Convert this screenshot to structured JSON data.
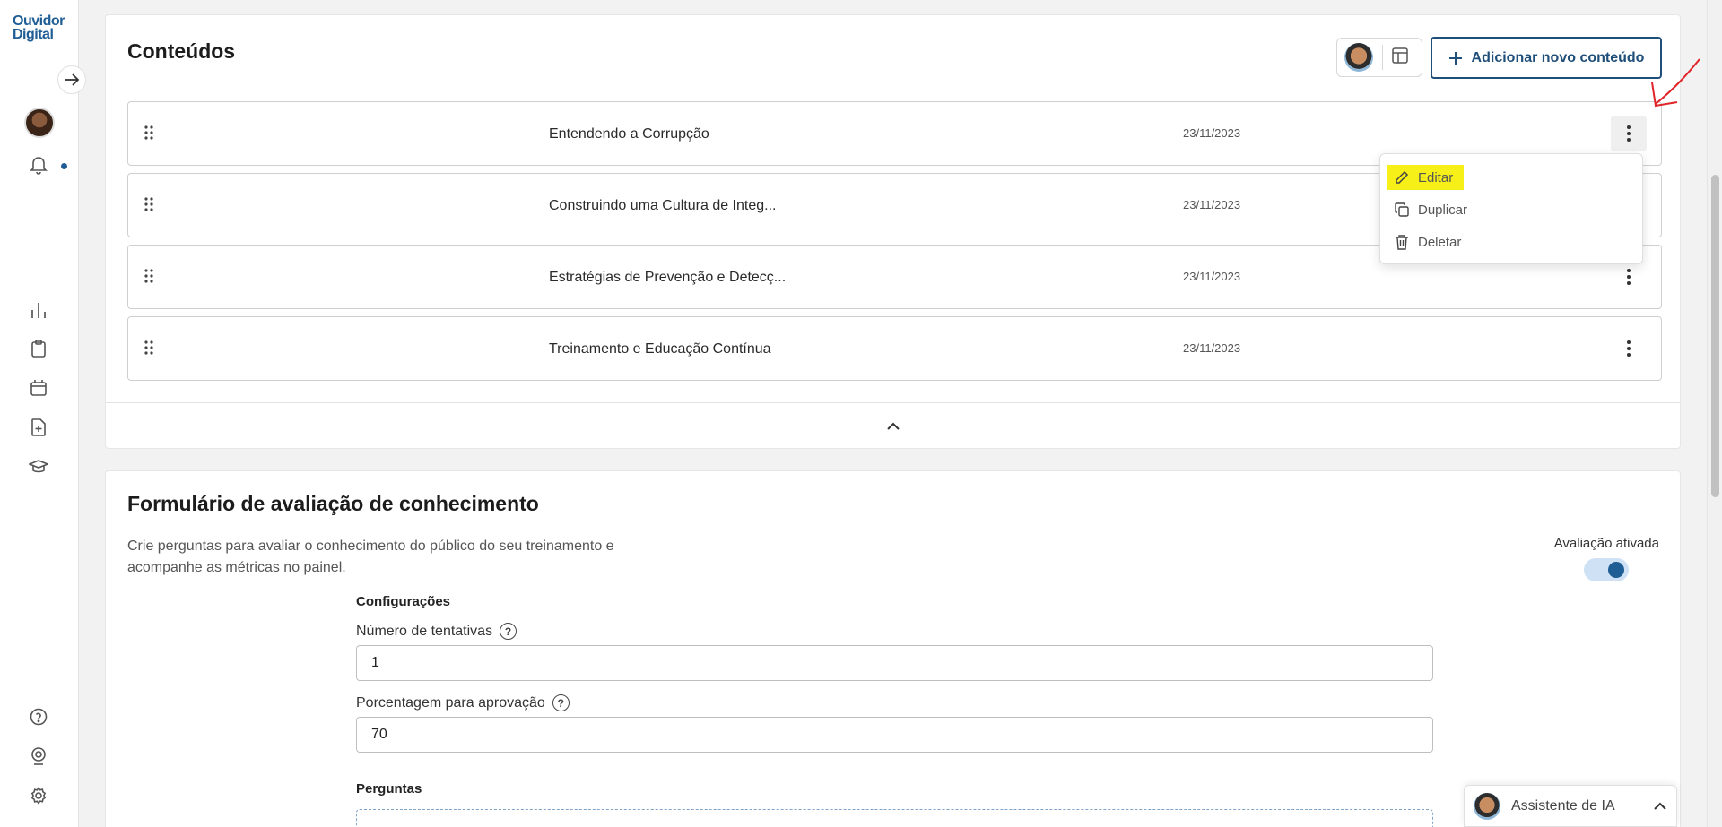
{
  "brand": {
    "logo_line1": "Ouvidor",
    "logo_line2": "Digital"
  },
  "contents": {
    "title": "Conteúdos",
    "add_button_label": "Adicionar novo conteúdo",
    "items": [
      {
        "title": "Entendendo a Corrupção",
        "date": "23/11/2023"
      },
      {
        "title": "Construindo uma Cultura de Integ...",
        "date": "23/11/2023"
      },
      {
        "title": "Estratégias de Prevenção e Detecç...",
        "date": "23/11/2023"
      },
      {
        "title": "Treinamento e Educação Contínua",
        "date": "23/11/2023"
      }
    ],
    "menu": {
      "edit": "Editar",
      "duplicate": "Duplicar",
      "delete": "Deletar"
    }
  },
  "form": {
    "title": "Formulário de avaliação de conhecimento",
    "description": "Crie perguntas para avaliar o conhecimento do público do seu treinamento e acompanhe as métricas no painel.",
    "toggle_label": "Avaliação ativada",
    "toggle_on": true,
    "config_title": "Configurações",
    "attempts_label": "Número de tentativas",
    "attempts_value": "1",
    "approval_label": "Porcentagem para aprovação",
    "approval_value": "70",
    "questions_title": "Perguntas"
  },
  "assistant": {
    "label": "Assistente de IA"
  },
  "colors": {
    "primary": "#1f5d95",
    "highlight": "#f7f018",
    "annotation": "#e0242a"
  }
}
